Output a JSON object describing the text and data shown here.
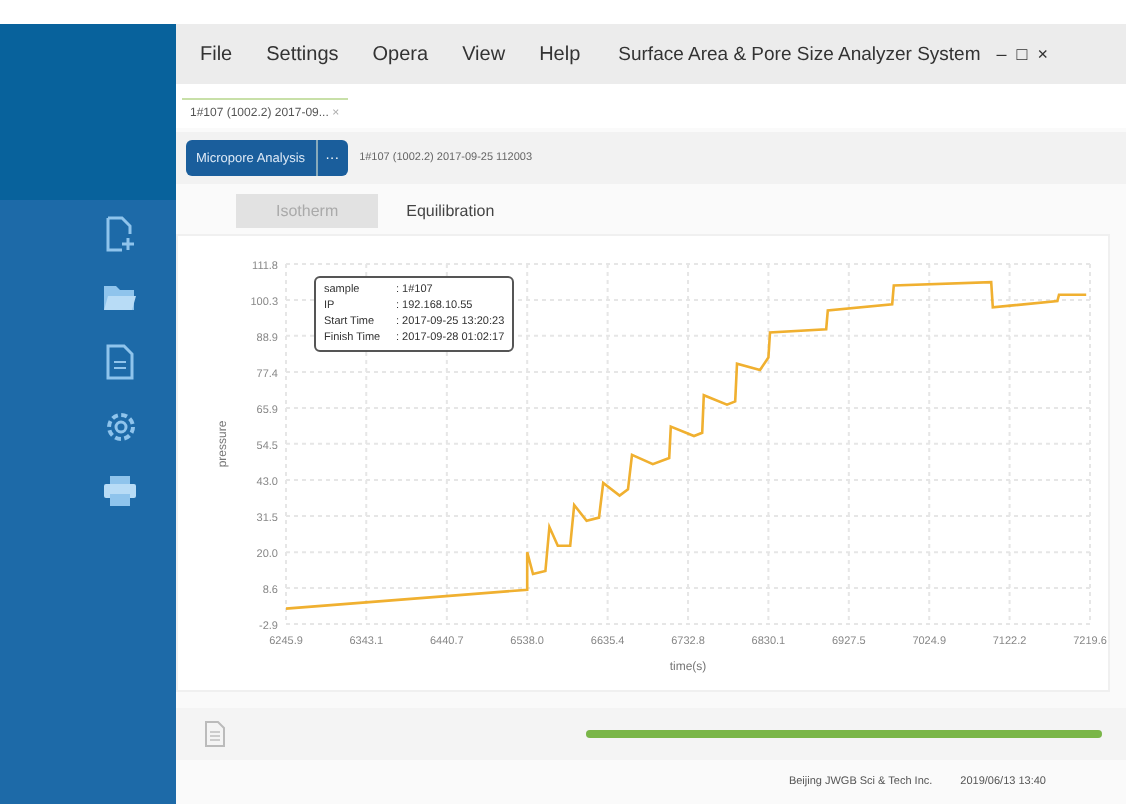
{
  "menu": [
    "File",
    "Settings",
    "Opera",
    "View",
    "Help"
  ],
  "window": {
    "title": "Surface Area & Pore Size Analyzer System",
    "controls": [
      "–",
      "□",
      "×"
    ]
  },
  "sidebar": {
    "items": [
      {
        "kind": "new"
      },
      {
        "kind": "open"
      },
      {
        "kind": "report"
      },
      {
        "kind": "settings"
      },
      {
        "kind": "print"
      }
    ]
  },
  "doc_tabs": [
    {
      "label": "1#107 (1002.2) 2017-09...",
      "close": "×",
      "selected": true
    }
  ],
  "toolbar": {
    "button": "Micropore Analysis",
    "more": "···",
    "file": "1#107 (1002.2) 2017-09-25 112003"
  },
  "view_tabs": [
    {
      "label": "Isotherm",
      "selected": false
    },
    {
      "label": "Equilibration",
      "selected": true
    }
  ],
  "tooltip": [
    {
      "key": "sample",
      "value": ": 1#107"
    },
    {
      "key": "IP",
      "value": ": 192.168.10.55"
    },
    {
      "key": "Start Time",
      "value": ": 2017-09-25 13:20:23"
    },
    {
      "key": "Finish Time",
      "value": ": 2017-09-28 01:02:17"
    }
  ],
  "chart_data": {
    "type": "line",
    "xlabel": "time(s)",
    "ylabel": "pressure",
    "x": [
      6245.9,
      6538,
      6538,
      6545,
      6560,
      6565,
      6575,
      6590,
      6595,
      6610,
      6625,
      6630,
      6650,
      6660,
      6665,
      6690,
      6710,
      6712,
      6740,
      6750,
      6752,
      6780,
      6790,
      6792,
      6820,
      6830,
      6832,
      6900,
      6902,
      6980,
      6982,
      7100,
      7102,
      7180,
      7182,
      7215
    ],
    "grid": true,
    "series": [
      {
        "color": "#f0b030",
        "values": [
          2,
          8,
          20,
          13,
          14,
          28,
          22,
          22,
          35,
          30,
          31,
          42,
          38,
          40,
          51,
          48,
          50,
          60,
          57,
          58,
          70,
          67,
          68,
          80,
          78,
          82,
          90,
          91,
          97,
          99,
          105,
          106,
          98,
          100,
          102,
          102
        ]
      }
    ],
    "xlim": [
      6245.9,
      7219.6
    ],
    "ylim": [
      -2.9,
      111.8
    ],
    "xticks": [
      {
        "value": 6245.9,
        "label": "6245.9"
      },
      {
        "value": 6343.1,
        "label": "6343.1"
      },
      {
        "value": 6440.7,
        "label": "6440.7"
      },
      {
        "value": 6538,
        "label": "6538.0"
      },
      {
        "value": 6635.4,
        "label": "6635.4"
      },
      {
        "value": 6732.8,
        "label": "6732.8"
      },
      {
        "value": 6830.1,
        "label": "6830.1"
      },
      {
        "value": 6927.5,
        "label": "6927.5"
      },
      {
        "value": 7024.9,
        "label": "7024.9"
      },
      {
        "value": 7122.2,
        "label": "7122.2"
      },
      {
        "value": 7219.6,
        "label": "7219.6"
      }
    ],
    "yticks": [
      {
        "value": -2.9,
        "label": "-2.9"
      },
      {
        "value": 8.6,
        "label": "8.6"
      },
      {
        "value": 20,
        "label": "20.0"
      },
      {
        "value": 31.5,
        "label": "31.5"
      },
      {
        "value": 43,
        "label": "43.0"
      },
      {
        "value": 54.5,
        "label": "54.5"
      },
      {
        "value": 65.9,
        "label": "65.9"
      },
      {
        "value": 77.4,
        "label": "77.4"
      },
      {
        "value": 88.9,
        "label": "88.9"
      },
      {
        "value": 100.3,
        "label": "100.3"
      },
      {
        "value": 111.8,
        "label": "111.8"
      }
    ]
  },
  "progress": {
    "level": 1
  },
  "status_bar": {
    "company": "Beijing JWGB Sci & Tech Inc.",
    "time": "2019/06/13 13:40"
  }
}
